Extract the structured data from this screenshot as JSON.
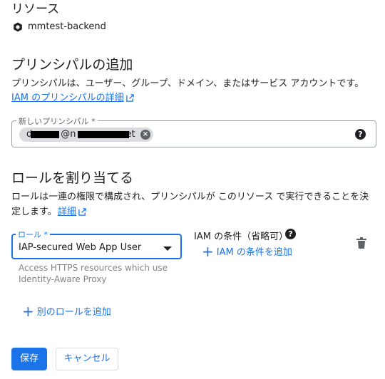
{
  "resource": {
    "heading": "リソース",
    "name": "mmtest-backend",
    "icon": "hexagon-icon"
  },
  "principal": {
    "heading": "プリンシパルの追加",
    "description": "プリンシパルは、ユーザー、グループ、ドメイン、またはサービス アカウントです。",
    "details_link": "IAM のプリンシパルの詳細",
    "field_label": "新しいプリンシパル *",
    "chip_text_start": "d",
    "chip_text_at": "@n",
    "chip_text_end": "et"
  },
  "roles": {
    "heading": "ロールを割り当てる",
    "description": "ロールは一連の権限で構成され、プリンシパルが このリソース で実行できることを決定します。",
    "details_link": "詳細",
    "role_label": "ロール *",
    "role_value": "IAP-secured Web App User",
    "role_hint_line1": "Access HTTPS resources which use",
    "role_hint_line2": "Identity-Aware Proxy",
    "condition_title": "IAM の条件（省略可）",
    "add_condition": "IAM の条件を追加",
    "add_role": "別のロールを追加"
  },
  "actions": {
    "save": "保存",
    "cancel": "キャンセル"
  },
  "colors": {
    "accent": "#1a73e8",
    "text": "#202124",
    "muted": "#5f6368"
  }
}
